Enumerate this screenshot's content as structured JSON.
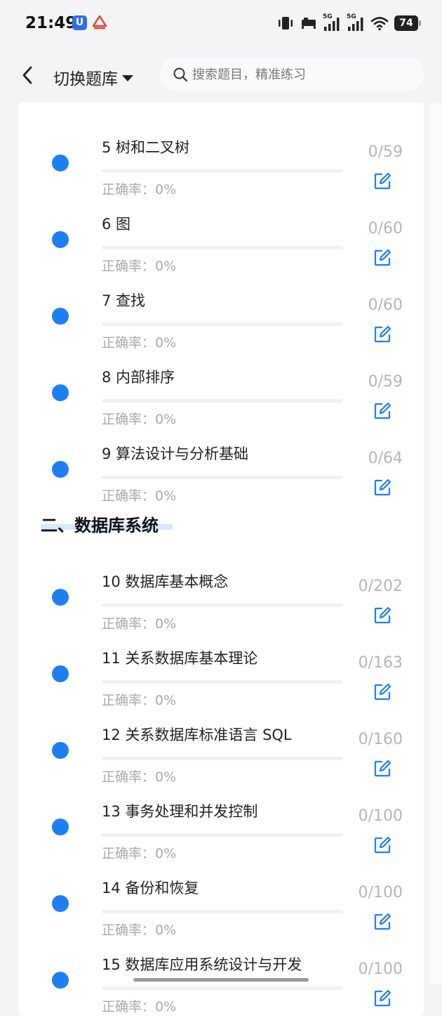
{
  "status_bar": {
    "time": "21:49",
    "battery": "74",
    "network_a": "5G",
    "network_b": "5G"
  },
  "header": {
    "bank_switch_label": "切换题库",
    "search_placeholder": "搜索题目，精准练习"
  },
  "chapters_a": [
    {
      "title": "5 树和二叉树",
      "accuracy": "正确率：0%",
      "count": "0/59",
      "progress": 0
    },
    {
      "title": "6 图",
      "accuracy": "正确率：0%",
      "count": "0/60",
      "progress": 0
    },
    {
      "title": "7 查找",
      "accuracy": "正确率：0%",
      "count": "0/60",
      "progress": 0
    },
    {
      "title": "8 内部排序",
      "accuracy": "正确率：0%",
      "count": "0/59",
      "progress": 0
    },
    {
      "title": "9 算法设计与分析基础",
      "accuracy": "正确率：0%",
      "count": "0/64",
      "progress": 0
    }
  ],
  "section_title": "二、数据库系统",
  "chapters_b": [
    {
      "title": "10 数据库基本概念",
      "accuracy": "正确率：0%",
      "count": "0/202",
      "progress": 0
    },
    {
      "title": "11 关系数据库基本理论",
      "accuracy": "正确率：0%",
      "count": "0/163",
      "progress": 0
    },
    {
      "title": "12 关系数据库标准语言 SQL",
      "accuracy": "正确率：0%",
      "count": "0/160",
      "progress": 0
    },
    {
      "title": "13 事务处理和并发控制",
      "accuracy": "正确率：0%",
      "count": "0/100",
      "progress": 0
    },
    {
      "title": "14 备份和恢复",
      "accuracy": "正确率：0%",
      "count": "0/100",
      "progress": 0
    },
    {
      "title": "15 数据库应用系统设计与开发",
      "accuracy": "正确率：0%",
      "count": "0/100",
      "progress": 0
    }
  ],
  "colors": {
    "accent": "#1e7ff0",
    "muted": "#a8a8a8"
  }
}
